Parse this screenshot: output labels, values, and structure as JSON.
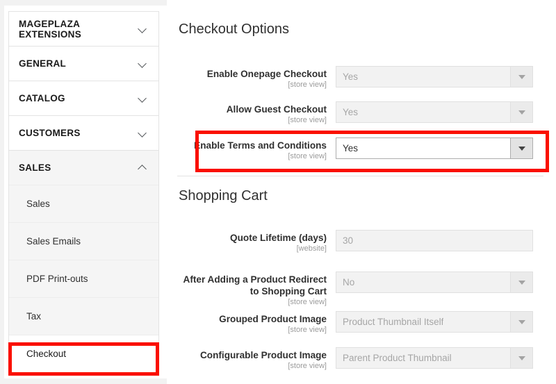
{
  "sidebar": {
    "sections": [
      {
        "label": "MAGEPLAZA EXTENSIONS",
        "icon": "chevron-down-icon",
        "expanded": false
      },
      {
        "label": "GENERAL",
        "icon": "chevron-down-icon",
        "expanded": false
      },
      {
        "label": "CATALOG",
        "icon": "chevron-down-icon",
        "expanded": false
      },
      {
        "label": "CUSTOMERS",
        "icon": "chevron-down-icon",
        "expanded": false
      },
      {
        "label": "SALES",
        "icon": "chevron-up-icon",
        "expanded": true
      }
    ],
    "sales_items": [
      {
        "label": "Sales",
        "current": false
      },
      {
        "label": "Sales Emails",
        "current": false
      },
      {
        "label": "PDF Print-outs",
        "current": false
      },
      {
        "label": "Tax",
        "current": false
      },
      {
        "label": "Checkout",
        "current": true
      }
    ]
  },
  "main": {
    "checkout_options": {
      "title": "Checkout Options",
      "fields": [
        {
          "label": "Enable Onepage Checkout",
          "scope": "[store view]",
          "value": "Yes",
          "control": "select",
          "enabled": false
        },
        {
          "label": "Allow Guest Checkout",
          "scope": "[store view]",
          "value": "Yes",
          "control": "select",
          "enabled": false
        },
        {
          "label": "Enable Terms and Conditions",
          "scope": "[store view]",
          "value": "Yes",
          "control": "select",
          "enabled": true
        }
      ]
    },
    "shopping_cart": {
      "title": "Shopping Cart",
      "fields": [
        {
          "label": "Quote Lifetime (days)",
          "scope": "[website]",
          "value": "30",
          "control": "text",
          "enabled": false
        },
        {
          "label": "After Adding a Product Redirect to Shopping Cart",
          "scope": "[store view]",
          "value": "No",
          "control": "select",
          "enabled": false
        },
        {
          "label": "Grouped Product Image",
          "scope": "[store view]",
          "value": "Product Thumbnail Itself",
          "control": "select",
          "enabled": false
        },
        {
          "label": "Configurable Product Image",
          "scope": "[store view]",
          "value": "Parent Product Thumbnail",
          "control": "select",
          "enabled": false
        }
      ]
    }
  },
  "highlights": {
    "color": "#fa0f00",
    "targets": [
      "sidebar-item-checkout",
      "field-enable-terms-and-conditions"
    ]
  }
}
